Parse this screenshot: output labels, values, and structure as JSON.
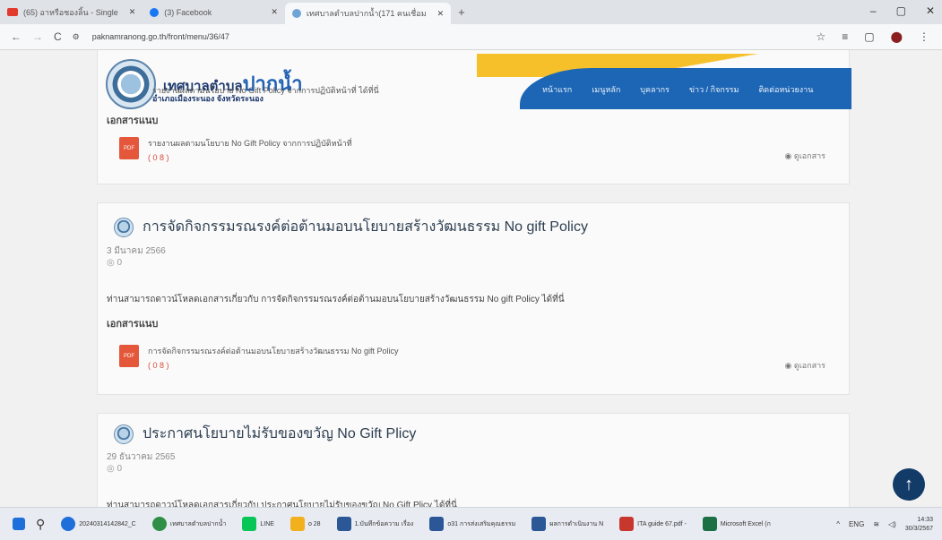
{
  "browser": {
    "tabs": [
      {
        "label": "(65) อาหรือชองลิ้น - Single",
        "fav": "#e23b2e"
      },
      {
        "label": "(3) Facebook",
        "fav": "#1877f2"
      },
      {
        "label": "เทศบาลตำบลปากน้ำ(171 คนเชื่อม",
        "fav": "#6fa4d6",
        "active": true
      }
    ],
    "new_tab": "+",
    "url": "paknamranong.go.th/front/menu/36/47",
    "window_controls": [
      "–",
      "▢",
      "✕"
    ],
    "addr_icons": [
      "☆",
      "≡",
      "▢",
      "⬤",
      "⋮"
    ]
  },
  "site": {
    "logo_small": "เทศบาลตำบล",
    "logo_big": "ปากน้ำ",
    "logo_sub": "อำเภอเมืองระนอง จังหวัดระนอง",
    "logo_overlap_text": "รายงานผลตามนโยบาย No Gift Policy จากการปฏิบัติหน้าที่ ได้ที่นี่",
    "nav": [
      "หน้าแรก",
      "เมนูหลัก",
      "บุคลากร",
      "ข่าว / กิจกรรม",
      "ติดต่อหน่วยงาน"
    ]
  },
  "cards": [
    {
      "attach_label": "เอกสารแนบ",
      "file_name": "รายงานผลตามนโยบาย No Gift Policy จากการปฏิบัติหน้าที่",
      "file_count": "( 0 8 )",
      "view_label": "ดูเอกสาร",
      "pdf_label": "PDF"
    },
    {
      "title": "การจัดกิจกรรมรณรงค์ต่อต้านมอบนโยบายสร้างวัฒนธรรม No gift Policy",
      "date": "3 มีนาคม 2566",
      "views": "0",
      "desc": "ท่านสามารถดาวน์โหลดเอกสารเกี่ยวกับ การจัดกิจกรรมรณรงค์ต่อต้านมอบนโยบายสร้างวัฒนธรรม No gift Policy ได้ที่นี่",
      "attach_label": "เอกสารแนบ",
      "file_name": "การจัดกิจกรรมรณรงค์ต่อต้านมอบนโยบายสร้างวัฒนธรรม No gift Policy",
      "file_count": "( 0 8 )",
      "view_label": "ดูเอกสาร",
      "pdf_label": "PDF"
    },
    {
      "title": "ประกาศนโยบายไม่รับของขวัญ No Gift Plicy",
      "date": "29 ธันวาคม 2565",
      "views": "0",
      "desc": "ท่านสามารถดาวน์โหลดเอกสารเกี่ยวกับ ประกาศนโยบายไม่รับของขวัญ No Gift Plicy ได้ที่นี่"
    }
  ],
  "scroll_top_icon": "↑",
  "taskbar": {
    "items": [
      {
        "label": "20240314142842_C",
        "color": "#1e6fd9"
      },
      {
        "label": "เทศบาลตำบลปากน้ำ",
        "color": "#2f8f46"
      },
      {
        "label": "LINE",
        "color": "#06c755"
      },
      {
        "label": "o 28",
        "color": "#f2b01e"
      },
      {
        "label": "1.บันทึกข้อความ เรื่อง",
        "color": "#2b5797"
      },
      {
        "label": "o31 การส่งเสริมคุณธรรม",
        "color": "#2b5797"
      },
      {
        "label": "ผลการดำเนินงาน N",
        "color": "#2b5797"
      },
      {
        "label": "ITA guide 67.pdf -",
        "color": "#c8372d"
      },
      {
        "label": "Microsoft Excel (ก",
        "color": "#1d7044"
      }
    ],
    "lang": "ENG",
    "time": "14:33",
    "date": "30/3/2567"
  }
}
